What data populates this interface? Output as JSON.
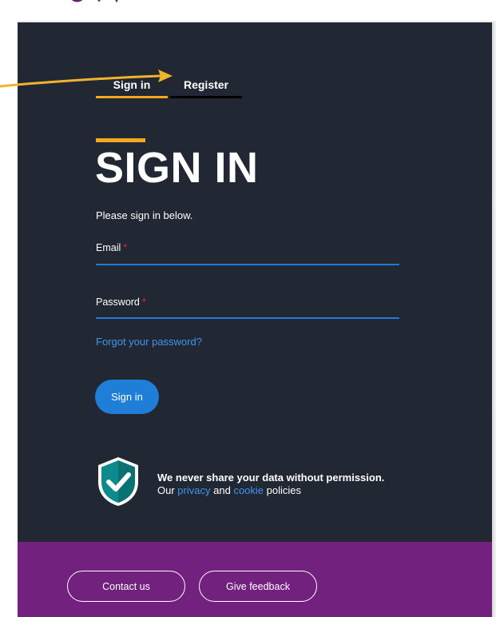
{
  "colors": {
    "panel_bg": "#222833",
    "accent": "#f5a81c",
    "link": "#3d95ee",
    "field_underline": "#1f7bd6",
    "button": "#1e7ed8",
    "required": "#e0262e",
    "footer_bg": "#73217f",
    "shield": "#0f8a8c",
    "annotation_arrow": "#f0b32c"
  },
  "tabs": [
    {
      "label": "Sign in",
      "active": true
    },
    {
      "label": "Register",
      "active": false
    }
  ],
  "main": {
    "title": "SIGN IN",
    "intro": "Please sign in below."
  },
  "form": {
    "email_label": "Email",
    "password_label": "Password",
    "required_marker": "*",
    "forgot_link": "Forgot your password?",
    "submit_label": "Sign in"
  },
  "privacy": {
    "icon": "shield-check-icon",
    "headline": "We never share your data without permission.",
    "prefix": "Our",
    "privacy_link": "privacy",
    "and": "and",
    "cookie_link": "cookie",
    "suffix": "policies"
  },
  "footer": {
    "contact_label": "Contact us",
    "feedback_label": "Give feedback"
  },
  "annotation": {
    "icon": "arrow-pointer-icon",
    "target": "Register"
  }
}
